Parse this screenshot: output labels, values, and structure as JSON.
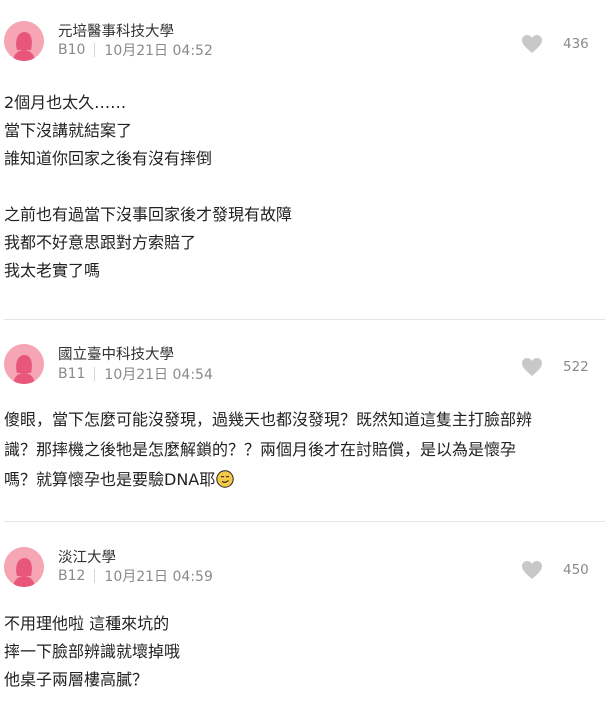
{
  "comments": [
    {
      "school": "元培醫事科技大學",
      "floor": "B10",
      "time": "10月21日 04:52",
      "likes": "436",
      "lines": [
        "2個月也太久……",
        "當下沒講就結案了",
        "誰知道你回家之後有沒有摔倒",
        "",
        "之前也有過當下沒事回家後才發現有故障",
        "我都不好意思跟對方索賠了",
        "我太老實了嗎"
      ]
    },
    {
      "school": "國立臺中科技大學",
      "floor": "B11",
      "time": "10月21日 04:54",
      "likes": "522",
      "lines": [
        "傻眼，當下怎麼可能沒發現，過幾天也都沒發現？既然知道這隻主打臉部辨",
        "識？那摔機之後牠是怎麼解鎖的？？兩個月後才在討賠償，是以為是懷孕",
        "嗎？就算懷孕也是要驗DNA耶"
      ],
      "emoji": "smirk-face-emoji"
    },
    {
      "school": "淡江大學",
      "floor": "B12",
      "time": "10月21日 04:59",
      "likes": "450",
      "lines": [
        "不用理他啦 這種來坑的",
        "摔一下臉部辨識就壞掉哦",
        "他桌子兩層樓高膩？"
      ]
    }
  ],
  "colors": {
    "avatar_bg": "#f5a5b4",
    "avatar_figure": "#e8577a",
    "like_icon": "#c8c8c8",
    "meta_text": "#8a8a8a",
    "divider": "#e5e5e5"
  },
  "icons": {
    "avatar": "female-avatar-icon",
    "like": "heart-icon"
  }
}
